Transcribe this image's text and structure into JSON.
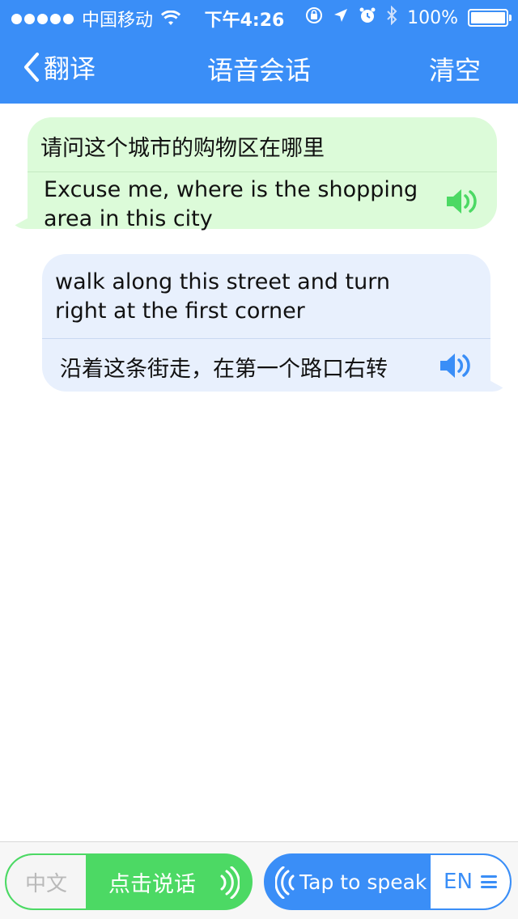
{
  "status_bar": {
    "carrier": "中国移动",
    "time": "下午4:26",
    "battery": "100%",
    "battery_level": 1.0
  },
  "nav": {
    "back_label": "翻译",
    "title": "语音会话",
    "clear_label": "清空"
  },
  "messages": [
    {
      "source_text": "请问这个城市的购物区在哪里",
      "translation_text": "Excuse me, where is the shopping area in this city",
      "color": "#dcfbd9",
      "speaker_color": "#4cd964"
    },
    {
      "source_text": "walk along this street and turn right at the first corner",
      "translation_text": "沿着这条街走，在第一个路口右转",
      "color": "#e8f0fd",
      "speaker_color": "#3a8ef7"
    }
  ],
  "bottom_bar": {
    "chinese": {
      "lang_label": "中文",
      "speak_label": "点击说话",
      "color": "#4cd964"
    },
    "english": {
      "speak_label": "Tap to speak",
      "lang_label": "EN",
      "color": "#3a8ef7"
    }
  },
  "colors": {
    "accent": "#3a8ef7",
    "green": "#4cd964"
  },
  "icons": [
    "back-chevron-icon",
    "wifi-icon",
    "rotation-lock-icon",
    "location-arrow-icon",
    "alarm-icon",
    "bluetooth-icon",
    "battery-icon",
    "speaker-icon",
    "sound-wave-icon",
    "menu-icon"
  ]
}
